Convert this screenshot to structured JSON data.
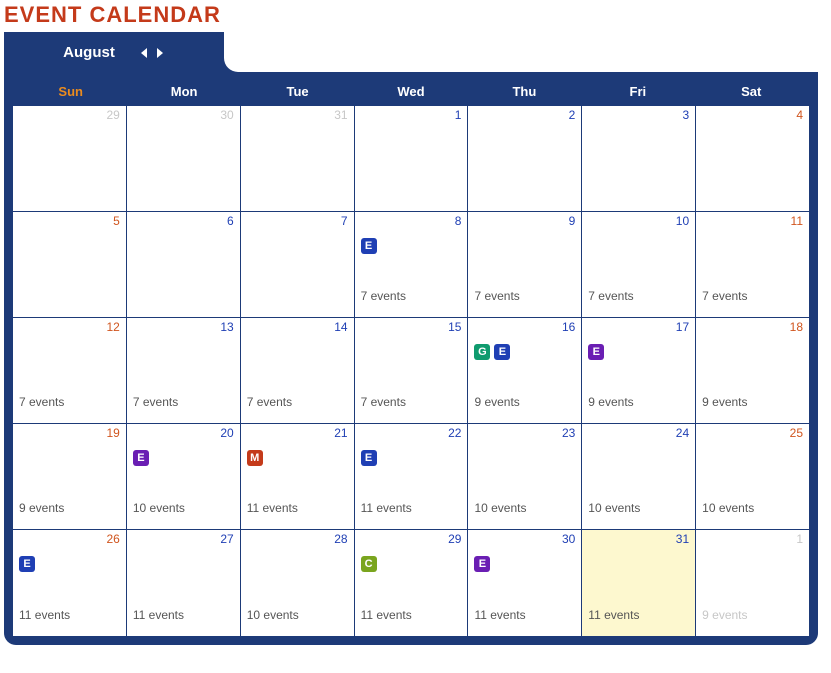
{
  "title": "EVENT CALENDAR",
  "month": "August",
  "dow": [
    "Sun",
    "Mon",
    "Tue",
    "Wed",
    "Thu",
    "Fri",
    "Sat"
  ],
  "badge_letters": {
    "E-blue": "E",
    "E-purple": "E",
    "G": "G",
    "M": "M",
    "C": "C"
  },
  "weeks": [
    [
      {
        "num": "29",
        "cls": "out"
      },
      {
        "num": "30",
        "cls": "out"
      },
      {
        "num": "31",
        "cls": "out"
      },
      {
        "num": "1",
        "cls": "wk"
      },
      {
        "num": "2",
        "cls": "wk"
      },
      {
        "num": "3",
        "cls": "wk"
      },
      {
        "num": "4",
        "cls": "sat"
      }
    ],
    [
      {
        "num": "5",
        "cls": "sun"
      },
      {
        "num": "6",
        "cls": "wk"
      },
      {
        "num": "7",
        "cls": "wk"
      },
      {
        "num": "8",
        "cls": "wk",
        "badges": [
          "E-blue"
        ],
        "events": "7 events"
      },
      {
        "num": "9",
        "cls": "wk",
        "events": "7 events"
      },
      {
        "num": "10",
        "cls": "wk",
        "events": "7 events"
      },
      {
        "num": "11",
        "cls": "sat",
        "events": "7 events"
      }
    ],
    [
      {
        "num": "12",
        "cls": "sun",
        "events": "7 events"
      },
      {
        "num": "13",
        "cls": "wk",
        "events": "7 events"
      },
      {
        "num": "14",
        "cls": "wk",
        "events": "7 events"
      },
      {
        "num": "15",
        "cls": "wk",
        "events": "7 events"
      },
      {
        "num": "16",
        "cls": "wk",
        "badges": [
          "G",
          "E-blue"
        ],
        "events": "9 events"
      },
      {
        "num": "17",
        "cls": "wk",
        "badges": [
          "E-purple"
        ],
        "events": "9 events"
      },
      {
        "num": "18",
        "cls": "sat",
        "events": "9 events"
      }
    ],
    [
      {
        "num": "19",
        "cls": "sun",
        "events": "9 events"
      },
      {
        "num": "20",
        "cls": "wk",
        "badges": [
          "E-purple"
        ],
        "events": "10 events"
      },
      {
        "num": "21",
        "cls": "wk",
        "badges": [
          "M"
        ],
        "events": "11 events"
      },
      {
        "num": "22",
        "cls": "wk",
        "badges": [
          "E-blue"
        ],
        "events": "11 events"
      },
      {
        "num": "23",
        "cls": "wk",
        "events": "10 events"
      },
      {
        "num": "24",
        "cls": "wk",
        "events": "10 events"
      },
      {
        "num": "25",
        "cls": "sat",
        "events": "10 events"
      }
    ],
    [
      {
        "num": "26",
        "cls": "sun",
        "badges": [
          "E-blue"
        ],
        "events": "11 events"
      },
      {
        "num": "27",
        "cls": "wk",
        "events": "11 events"
      },
      {
        "num": "28",
        "cls": "wk",
        "events": "10 events"
      },
      {
        "num": "29",
        "cls": "wk",
        "badges": [
          "C"
        ],
        "events": "11 events"
      },
      {
        "num": "30",
        "cls": "wk",
        "badges": [
          "E-purple"
        ],
        "events": "11 events"
      },
      {
        "num": "31",
        "cls": "wk",
        "highlight": true,
        "events": "11 events"
      },
      {
        "num": "1",
        "cls": "out",
        "events": "9 events",
        "events_out": true
      }
    ]
  ]
}
